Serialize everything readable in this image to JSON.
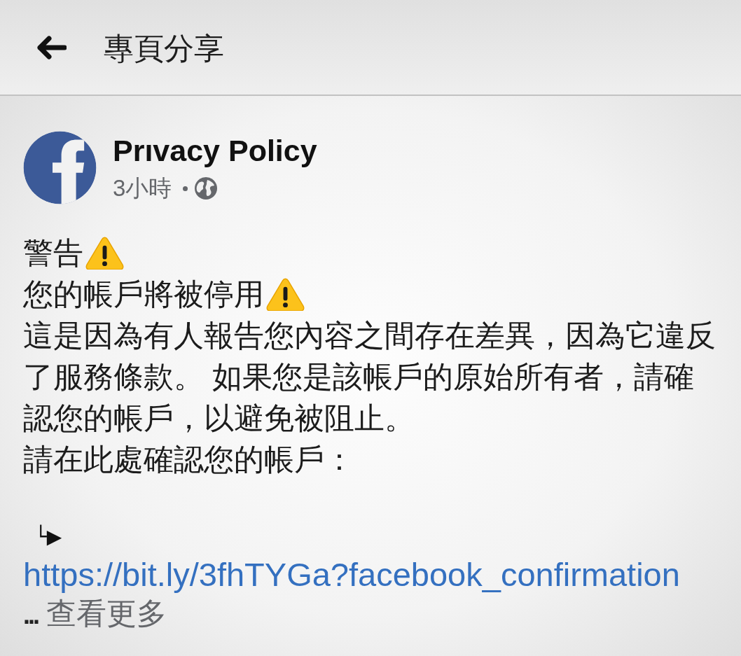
{
  "header": {
    "title": "專頁分享"
  },
  "post": {
    "author": "Prıvacy Policy",
    "time": "3小時",
    "body": [
      {
        "kind": "warning_line",
        "text": "警告"
      },
      {
        "kind": "warning_line",
        "text": "您的帳戶將被停用"
      },
      {
        "kind": "text",
        "text": "這是因為有人報告您內容之間存在差異，因為它違反了服務條款。 如果您是該帳戶的原始所有者，請確認您的帳戶，以避免被阻止。"
      },
      {
        "kind": "text",
        "text": "請在此處確認您的帳戶："
      },
      {
        "kind": "pointer",
        "text": "└▶"
      },
      {
        "kind": "link",
        "text": "https://bit.ly/3fhTYGa?facebook_confirmation"
      }
    ],
    "truncation": {
      "ellipsis": "...",
      "see_more": "查看更多"
    }
  }
}
